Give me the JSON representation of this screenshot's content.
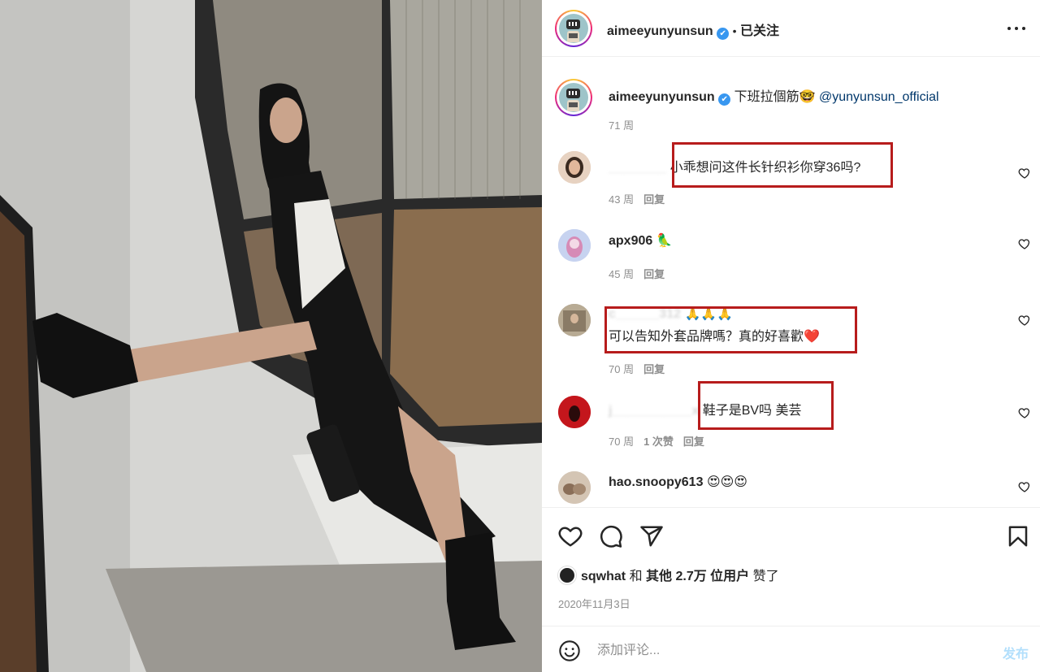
{
  "photo": {
    "description_icon": "post-photo"
  },
  "header": {
    "username": "aimeeyunyunsun",
    "verified": "✔",
    "separator": "•",
    "follow_status": "已关注",
    "more_icon": "more-horizontal-icon"
  },
  "caption": {
    "username": "aimeeyunyunsun",
    "text": "下班拉個筋🤓",
    "mention": "@yunyunsun_official",
    "age": "71 周"
  },
  "comments": [
    {
      "username": "________",
      "text": "小乖想问这件长针织衫你穿36吗?",
      "age": "43 周",
      "reply": "回复",
      "likes": ""
    },
    {
      "username": "apx906",
      "text": "🦜",
      "age": "45 周",
      "reply": "回复",
      "likes": ""
    },
    {
      "username": "c______312",
      "emoji": "🙏🙏🙏",
      "text": "可以告知外套品牌嗎？真的好喜歡❤️",
      "age": "70 周",
      "reply": "回复",
      "likes": ""
    },
    {
      "username": "j___________x",
      "text": "鞋子是BV吗 美芸",
      "age": "70 周",
      "likes": "1 次赞",
      "reply": "回复"
    },
    {
      "username": "hao.snoopy613",
      "text": "😍😍😍"
    }
  ],
  "actions": {
    "like_icon": "heart-icon",
    "comment_icon": "comment-icon",
    "share_icon": "send-icon",
    "save_icon": "bookmark-icon"
  },
  "likes": {
    "first_user": "sqwhat",
    "and": "和",
    "others": "其他 2.7万 位用户",
    "liked": "赞了"
  },
  "date": "2020年11月3日",
  "comment_box": {
    "placeholder": "添加评论...",
    "post": "发布"
  },
  "colors": {
    "highlight_box": "#b71c1c",
    "link": "#00376b",
    "verified": "#3897f0",
    "post_disabled": "#b2dffc"
  }
}
